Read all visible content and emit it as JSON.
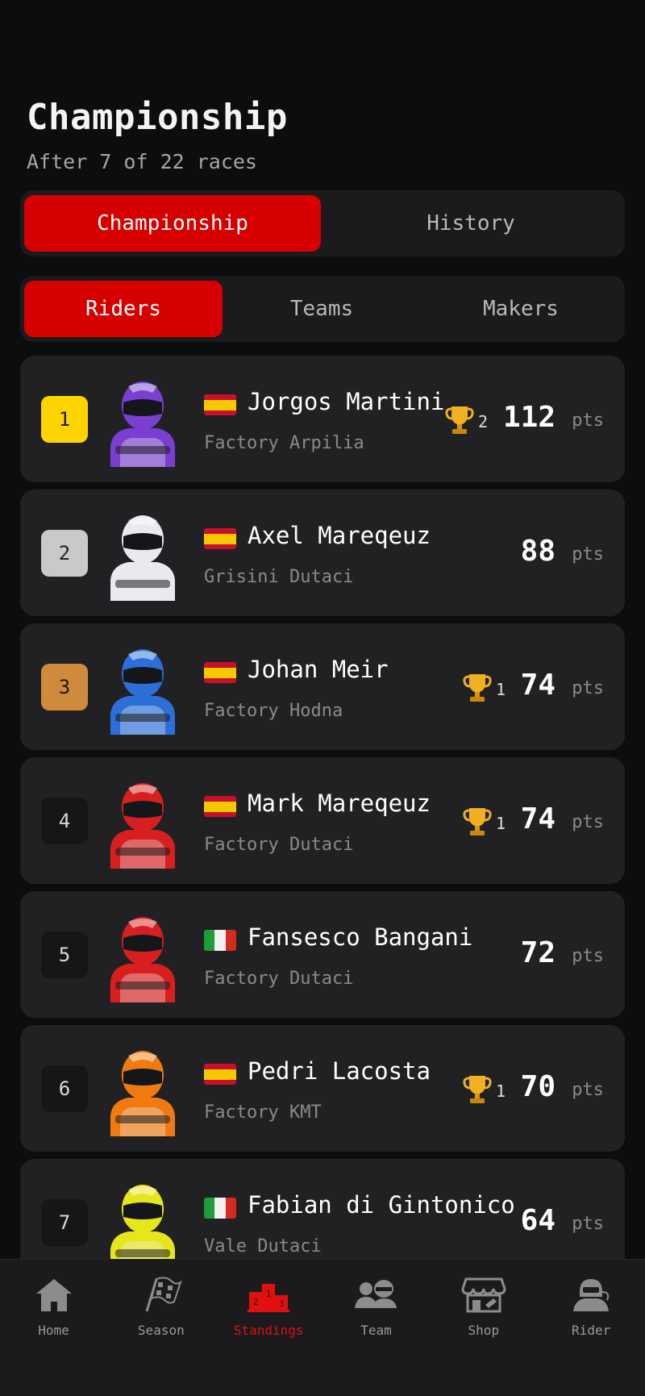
{
  "header": {
    "title": "Championship",
    "subtitle": "After 7 of 22 races"
  },
  "main_tabs": [
    {
      "label": "Championship",
      "active": true
    },
    {
      "label": "History",
      "active": false
    }
  ],
  "sub_tabs": [
    {
      "label": "Riders",
      "active": true
    },
    {
      "label": "Teams",
      "active": false
    },
    {
      "label": "Makers",
      "active": false
    }
  ],
  "standings": [
    {
      "rank": "1",
      "name": "Jorgos Martini",
      "team": "Factory Arpilia",
      "country": "spain-flag",
      "wins": "2",
      "points": "112",
      "pts_label": "pts",
      "helmet_color": "#7a3fd1"
    },
    {
      "rank": "2",
      "name": "Axel Mareqeuz",
      "team": "Grisini Dutaci",
      "country": "spain-flag",
      "wins": "",
      "points": "88",
      "pts_label": "pts",
      "helmet_color": "#e9e9ef"
    },
    {
      "rank": "3",
      "name": "Johan Meir",
      "team": "Factory Hodna",
      "country": "spain-flag",
      "wins": "1",
      "points": "74",
      "pts_label": "pts",
      "helmet_color": "#2c6fd8"
    },
    {
      "rank": "4",
      "name": "Mark Mareqeuz",
      "team": "Factory Dutaci",
      "country": "spain-flag",
      "wins": "1",
      "points": "74",
      "pts_label": "pts",
      "helmet_color": "#d81f1f"
    },
    {
      "rank": "5",
      "name": "Fansesco Bangani",
      "team": "Factory Dutaci",
      "country": "italy-flag",
      "wins": "",
      "points": "72",
      "pts_label": "pts",
      "helmet_color": "#d81f1f"
    },
    {
      "rank": "6",
      "name": "Pedri Lacosta",
      "team": "Factory KMT",
      "country": "spain-flag",
      "wins": "1",
      "points": "70",
      "pts_label": "pts",
      "helmet_color": "#f07a10"
    },
    {
      "rank": "7",
      "name": "Fabian di Gintonico",
      "team": "Vale Dutaci",
      "country": "italy-flag",
      "wins": "",
      "points": "64",
      "pts_label": "pts",
      "helmet_color": "#e6e61a"
    }
  ],
  "nav": [
    {
      "label": "Home",
      "icon": "home-icon",
      "active": false
    },
    {
      "label": "Season",
      "icon": "checkered-flag-icon",
      "active": false
    },
    {
      "label": "Standings",
      "icon": "podium-icon",
      "active": true
    },
    {
      "label": "Team",
      "icon": "team-icon",
      "active": false
    },
    {
      "label": "Shop",
      "icon": "shop-icon",
      "active": false
    },
    {
      "label": "Rider",
      "icon": "rider-icon",
      "active": false
    }
  ],
  "colors": {
    "accent": "#d60000",
    "background": "#0c0d0f",
    "card": "#212123",
    "gold": "#fdd400",
    "silver": "#c9c9c9",
    "bronze": "#d08a3c"
  }
}
